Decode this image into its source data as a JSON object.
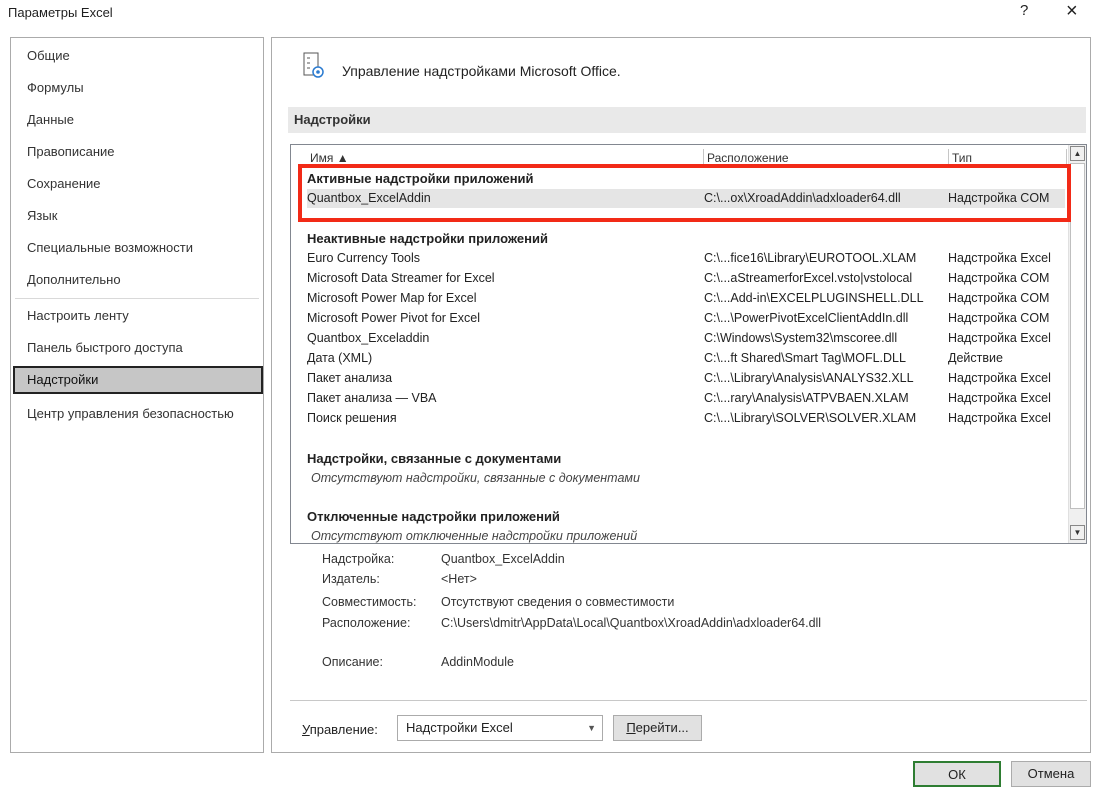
{
  "window": {
    "title": "Параметры Excel",
    "help_label": "?",
    "close_label": "×"
  },
  "sidebar": {
    "items": [
      {
        "label": "Общие"
      },
      {
        "label": "Формулы"
      },
      {
        "label": "Данные"
      },
      {
        "label": "Правописание"
      },
      {
        "label": "Сохранение"
      },
      {
        "label": "Язык"
      },
      {
        "label": "Специальные возможности"
      },
      {
        "label": "Дополнительно"
      },
      {
        "label": "Настроить ленту"
      },
      {
        "label": "Панель быстрого доступа"
      },
      {
        "label": "Надстройки"
      },
      {
        "label": "Центр управления безопасностью"
      }
    ],
    "selected": "Надстройки"
  },
  "main": {
    "header": "Управление надстройками Microsoft Office.",
    "section_title": "Надстройки",
    "columns": [
      "Имя ▲",
      "Расположение",
      "Тип"
    ],
    "groups": {
      "active_title": "Активные надстройки приложений",
      "active_rows": [
        {
          "name": "Quantbox_ExcelAddin",
          "location": "C:\\...ox\\XroadAddin\\adxloader64.dll",
          "type": "Надстройка COM"
        }
      ],
      "inactive_title": "Неактивные надстройки приложений",
      "inactive_rows": [
        {
          "name": "Euro Currency Tools",
          "location": "C:\\...fice16\\Library\\EUROTOOL.XLAM",
          "type": "Надстройка Excel"
        },
        {
          "name": "Microsoft Data Streamer for Excel",
          "location": "C:\\...aStreamerforExcel.vsto|vstolocal",
          "type": "Надстройка COM"
        },
        {
          "name": "Microsoft Power Map for Excel",
          "location": "C:\\...Add-in\\EXCELPLUGINSHELL.DLL",
          "type": "Надстройка COM"
        },
        {
          "name": "Microsoft Power Pivot for Excel",
          "location": "C:\\...\\PowerPivotExcelClientAddIn.dll",
          "type": "Надстройка COM"
        },
        {
          "name": "Quantbox_Exceladdin",
          "location": "C:\\Windows\\System32\\mscoree.dll",
          "type": "Надстройка Excel"
        },
        {
          "name": "Дата (XML)",
          "location": "C:\\...ft Shared\\Smart Tag\\MOFL.DLL",
          "type": "Действие"
        },
        {
          "name": "Пакет анализа",
          "location": "C:\\...\\Library\\Analysis\\ANALYS32.XLL",
          "type": "Надстройка Excel"
        },
        {
          "name": "Пакет анализа — VBA",
          "location": "C:\\...rary\\Analysis\\ATPVBAEN.XLAM",
          "type": "Надстройка Excel"
        },
        {
          "name": "Поиск решения",
          "location": "C:\\...\\Library\\SOLVER\\SOLVER.XLAM",
          "type": "Надстройка Excel"
        }
      ],
      "doc_title": "Надстройки, связанные с документами",
      "doc_empty": "Отсутствуют надстройки, связанные с документами",
      "disabled_title": "Отключенные надстройки приложений",
      "disabled_empty": "Отсутствуют отключенные надстройки приложений"
    },
    "details": {
      "addin_label": "Надстройка:",
      "addin_value": "Quantbox_ExcelAddin",
      "publisher_label": "Издатель:",
      "publisher_value": "<Нет>",
      "compat_label": "Совместимость:",
      "compat_value": "Отсутствуют сведения о совместимости",
      "location_label": "Расположение:",
      "location_value": "C:\\Users\\dmitr\\AppData\\Local\\Quantbox\\XroadAddin\\adxloader64.dll",
      "desc_label": "Описание:",
      "desc_value": "AddinModule"
    },
    "manage": {
      "label_u": "У",
      "label_rest": "правление:",
      "selected": "Надстройки Excel",
      "go_u": "П",
      "go_rest": "ерейти..."
    }
  },
  "footer": {
    "ok_label": "ОК",
    "cancel_label": "Отмена"
  },
  "colors": {
    "highlight": "#f22a17",
    "ok_border": "#2e7d32"
  }
}
